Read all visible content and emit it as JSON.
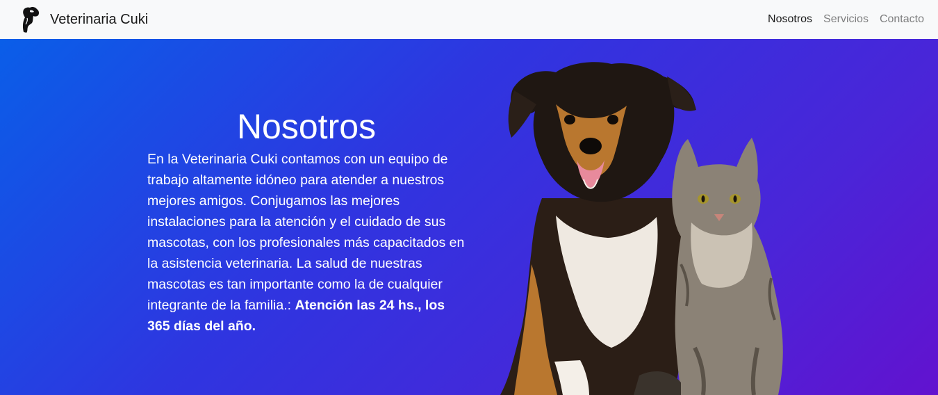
{
  "navbar": {
    "brand_name": "Veterinaria Cuki",
    "links": [
      {
        "label": "Nosotros",
        "active": true
      },
      {
        "label": "Servicios",
        "active": false
      },
      {
        "label": "Contacto",
        "active": false
      }
    ]
  },
  "hero": {
    "title": "Nosotros",
    "body": "En la Veterinaria Cuki contamos con un equipo de trabajo altamente idóneo para atender a nuestros mejores amigos. Conjugamos las mejores instalaciones para la atención y el cuidado de sus mascotas, con los profesionales más capacitados en la asistencia veterinaria. La salud de nuestras mascotas es tan importante como la de cualquier integrante de la familia.: ",
    "highlight": "Atención las 24 hs., los 365 días del año."
  },
  "colors": {
    "navbar_bg": "#f8f9fa",
    "hero_gradient_start": "#0a5ee8",
    "hero_gradient_end": "#6212cf"
  },
  "icons": {
    "logo": "pet-silhouette-logo",
    "pets_image": "dog-and-cat-photo"
  }
}
